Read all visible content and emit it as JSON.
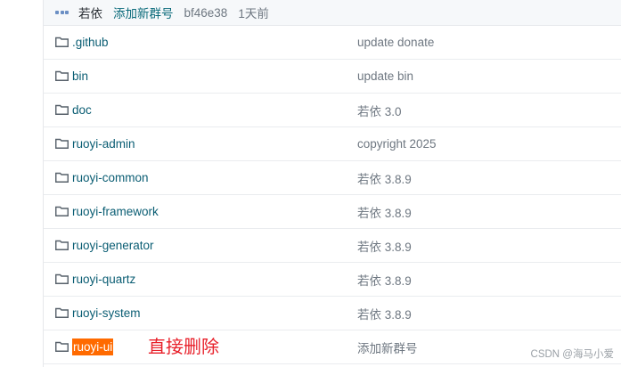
{
  "commit": {
    "author": "若依",
    "message": "添加新群号",
    "hash": "bf46e38",
    "time": "1天前"
  },
  "files": [
    {
      "name": ".github",
      "commit": "update donate",
      "icon": "folder-icon"
    },
    {
      "name": "bin",
      "commit": "update bin",
      "icon": "folder-icon"
    },
    {
      "name": "doc",
      "commit": "若依 3.0",
      "icon": "folder-icon"
    },
    {
      "name": "ruoyi-admin",
      "commit": "copyright 2025",
      "icon": "folder-icon"
    },
    {
      "name": "ruoyi-common",
      "commit": "若依 3.8.9",
      "icon": "folder-icon"
    },
    {
      "name": "ruoyi-framework",
      "commit": "若依 3.8.9",
      "icon": "folder-icon"
    },
    {
      "name": "ruoyi-generator",
      "commit": "若依 3.8.9",
      "icon": "folder-icon"
    },
    {
      "name": "ruoyi-quartz",
      "commit": "若依 3.8.9",
      "icon": "folder-icon"
    },
    {
      "name": "ruoyi-system",
      "commit": "若依 3.8.9",
      "icon": "folder-icon"
    },
    {
      "name": "ruoyi-ui",
      "commit": "添加新群号",
      "icon": "folder-icon",
      "highlighted": true
    }
  ],
  "annotation": "直接删除",
  "watermark": "CSDN @海马小爱",
  "colors": {
    "link": "#0a5d73",
    "highlight": "#ff6a00",
    "annotation": "#e8202a"
  }
}
